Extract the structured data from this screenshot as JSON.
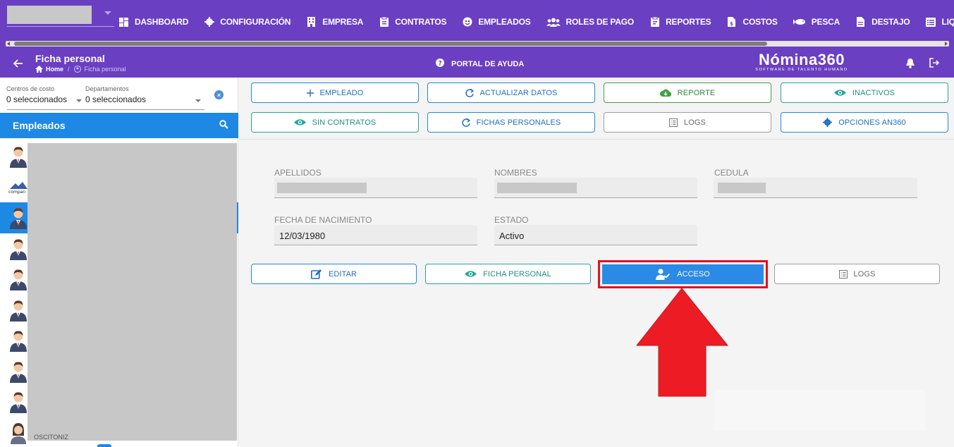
{
  "nav": {
    "items": [
      {
        "label": "DASHBOARD",
        "icon": "dashboard-icon"
      },
      {
        "label": "CONFIGURACIÓN",
        "icon": "gear-icon"
      },
      {
        "label": "EMPRESA",
        "icon": "building-icon"
      },
      {
        "label": "CONTRATOS",
        "icon": "clipboard-icon"
      },
      {
        "label": "EMPLEADOS",
        "icon": "user-circle-icon"
      },
      {
        "label": "ROLES DE PAGO",
        "icon": "users-icon"
      },
      {
        "label": "REPORTES",
        "icon": "report-icon"
      },
      {
        "label": "COSTOS",
        "icon": "cost-doc-icon"
      },
      {
        "label": "PESCA",
        "icon": "fish-icon"
      },
      {
        "label": "DESTAJO",
        "icon": "document-icon"
      },
      {
        "label": "LIQUIDACION",
        "icon": "list-icon"
      }
    ]
  },
  "header": {
    "title": "Ficha personal",
    "breadcrumb_home": "Home",
    "breadcrumb_current": "Ficha personal",
    "portal": "PORTAL DE AYUDA",
    "logo_name": "Nómina360",
    "logo_tag": "SOFTWARE DE TALENTO HUMANO"
  },
  "filters": {
    "centros_label": "Centros de costo",
    "centros_value": "0 seleccionados",
    "departamentos_label": "Departamentos",
    "departamentos_value": "0 seleccionados"
  },
  "employees": {
    "title": "Empleados",
    "tail": "OSCITONIZ"
  },
  "actions": {
    "empleado": "EMPLEADO",
    "actualizar": "ACTUALIZAR DATOS",
    "reporte": "REPORTE",
    "inactivos": "INACTIVOS",
    "sin_contratos": "SIN CONTRATOS",
    "fichas": "FICHAS PERSONALES",
    "logs": "LOGS",
    "opciones": "OPCIONES AN360"
  },
  "form": {
    "apellidos_label": "APELLIDOS",
    "nombres_label": "NOMBRES",
    "cedula_label": "CEDULA",
    "fecha_label": "FECHA DE NACIMIENTO",
    "fecha_value": "12/03/1980",
    "estado_label": "ESTADO",
    "estado_value": "Activo"
  },
  "record_actions": {
    "editar": "EDITAR",
    "ficha": "FICHA PERSONAL",
    "acceso": "ACCESO",
    "logs": "LOGS"
  },
  "colors": {
    "brand": "#6a3fc2",
    "primary": "#1e88e5",
    "highlight": "#e4111b"
  }
}
